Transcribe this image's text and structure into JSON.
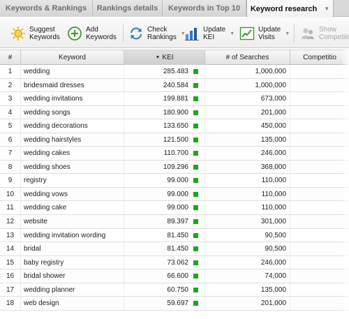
{
  "tabs": [
    {
      "label": "Keywords & Rankings"
    },
    {
      "label": "Rankings details"
    },
    {
      "label": "Keywords in Top 10"
    },
    {
      "label": "Keyword research"
    }
  ],
  "toolbar": {
    "suggest": "Suggest\nKeywords",
    "add": "Add\nKeywords",
    "check": "Check\nRankings",
    "update_kei": "Update\nKEI",
    "update_visits": "Update\nVisits",
    "show_competitors": "Show\nCompetito"
  },
  "table": {
    "headers": {
      "num": "#",
      "keyword": "Keyword",
      "kei": "KEI",
      "searches": "# of Searches",
      "competition": "Competitio"
    },
    "rows": [
      {
        "num": "1",
        "keyword": "wedding",
        "kei": "285.483",
        "searches": "1,000,000"
      },
      {
        "num": "2",
        "keyword": "bridesmaid dresses",
        "kei": "240.584",
        "searches": "1,000,000"
      },
      {
        "num": "3",
        "keyword": "wedding invitations",
        "kei": "199.881",
        "searches": "673,000"
      },
      {
        "num": "4",
        "keyword": "wedding songs",
        "kei": "180.900",
        "searches": "201,000"
      },
      {
        "num": "5",
        "keyword": "wedding decorations",
        "kei": "133.650",
        "searches": "450,000"
      },
      {
        "num": "6",
        "keyword": "wedding hairstyles",
        "kei": "121.500",
        "searches": "135,000"
      },
      {
        "num": "7",
        "keyword": "wedding cakes",
        "kei": "110.700",
        "searches": "246,000"
      },
      {
        "num": "8",
        "keyword": "wedding shoes",
        "kei": "109.296",
        "searches": "368,000"
      },
      {
        "num": "9",
        "keyword": "registry",
        "kei": "99.000",
        "searches": "110,000"
      },
      {
        "num": "10",
        "keyword": "wedding vows",
        "kei": "99.000",
        "searches": "110,000"
      },
      {
        "num": "11",
        "keyword": "wedding cake",
        "kei": "99.000",
        "searches": "110,000"
      },
      {
        "num": "12",
        "keyword": "website",
        "kei": "89.397",
        "searches": "301,000"
      },
      {
        "num": "13",
        "keyword": "wedding invitation wording",
        "kei": "81.450",
        "searches": "90,500"
      },
      {
        "num": "14",
        "keyword": "bridal",
        "kei": "81.450",
        "searches": "90,500"
      },
      {
        "num": "15",
        "keyword": "baby registry",
        "kei": "73.062",
        "searches": "246,000"
      },
      {
        "num": "16",
        "keyword": "bridal shower",
        "kei": "66.600",
        "searches": "74,000"
      },
      {
        "num": "17",
        "keyword": "wedding planner",
        "kei": "60.750",
        "searches": "135,000"
      },
      {
        "num": "18",
        "keyword": "web design",
        "kei": "59.697",
        "searches": "201,000"
      }
    ]
  },
  "colors": {
    "kei_indicator": "#1aa81a",
    "accent_blue": "#2f78c4",
    "accent_green": "#3a9a2e",
    "accent_orange": "#f0a800"
  },
  "icons": {
    "suggest": "sun-bulb-icon",
    "add": "plus-circle-icon",
    "check": "refresh-arrows-icon",
    "update_kei": "kei-chart-icon",
    "update_visits": "visits-chart-icon",
    "show_competitors": "competitors-icon",
    "sort": "sort-desc-icon"
  }
}
